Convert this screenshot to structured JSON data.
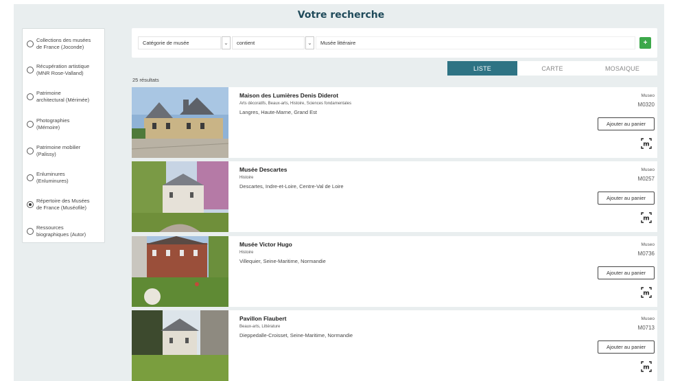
{
  "page_title": "Votre recherche",
  "sidebar": {
    "items": [
      {
        "label_1": "Collections des musées",
        "label_2": "de France (Joconde)",
        "checked": false
      },
      {
        "label_1": "Récupération artistique",
        "label_2": "(MNR Rose-Valland)",
        "checked": false
      },
      {
        "label_1": "Patrimoine",
        "label_2": "architectural (Mérimée)",
        "checked": false
      },
      {
        "label_1": "Photographies",
        "label_2": "(Mémoire)",
        "checked": false
      },
      {
        "label_1": "Patrimoine mobilier",
        "label_2": "(Palissy)",
        "checked": false
      },
      {
        "label_1": "Enluminures",
        "label_2": "(Enluminures)",
        "checked": false
      },
      {
        "label_1": "Répertoire des Musées",
        "label_2": "de France (Muséofile)",
        "checked": true
      },
      {
        "label_1": "Ressources",
        "label_2": "biographiques (Autor)",
        "checked": false
      }
    ]
  },
  "search": {
    "field": "Catégorie de musée",
    "operator": "contient",
    "value": "Musée littéraire",
    "add_label": "+"
  },
  "tabs": [
    {
      "label": "LISTE",
      "active": true
    },
    {
      "label": "CARTE",
      "active": false
    },
    {
      "label": "MOSAIQUE",
      "active": false
    }
  ],
  "result_count": "25 résultats",
  "results": [
    {
      "title": "Maison des Lumières Denis Diderot",
      "categories": "Arts décoratifs, Beaux-arts, Histoire, Sciences fondamentales",
      "location": "Langres, Haute-Marne, Grand Est",
      "source": "Museo",
      "ref": "M0320",
      "basket": "Ajouter au panier"
    },
    {
      "title": "Musée Descartes",
      "categories": "Histoire",
      "location": "Descartes, Indre-et-Loire, Centre-Val de Loire",
      "source": "Museo",
      "ref": "M0257",
      "basket": "Ajouter au panier"
    },
    {
      "title": "Musée Victor Hugo",
      "categories": "Histoire",
      "location": "Villequier, Seine-Maritime, Normandie",
      "source": "Museo",
      "ref": "M0736",
      "basket": "Ajouter au panier"
    },
    {
      "title": "Pavillon Flaubert",
      "categories": "Beaux-arts, Littérature",
      "location": "Dieppedalle-Croisset, Seine-Maritime, Normandie",
      "source": "Museo",
      "ref": "M0713",
      "basket": "Ajouter au panier"
    }
  ],
  "colors": {
    "accent": "#2e7384",
    "add_button": "#3ca84a",
    "panel_bg": "#e9eeef"
  },
  "icons": [
    "chevron-down-icon",
    "plus-icon",
    "museofile-m-icon"
  ]
}
